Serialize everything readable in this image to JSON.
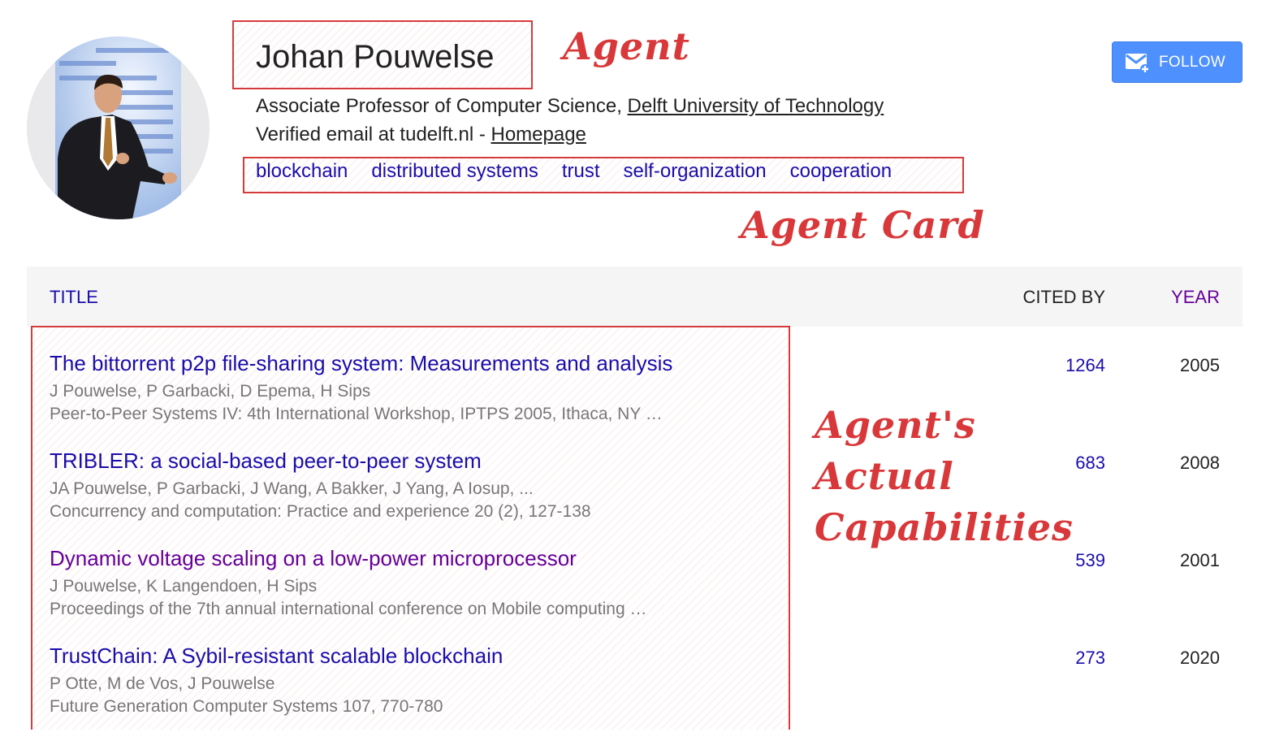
{
  "profile": {
    "name": "Johan Pouwelse",
    "affiliation_prefix": "Associate Professor of Computer Science, ",
    "affiliation_link": "Delft University of Technology",
    "email_prefix": "Verified email at tudelft.nl - ",
    "homepage_link": "Homepage",
    "interests": [
      "blockchain",
      "distributed systems",
      "trust",
      "self-organization",
      "cooperation"
    ],
    "follow_label": "FOLLOW",
    "follow_icon": "mail-plus-icon",
    "avatar_icon": "person-presenting-photo"
  },
  "annotations": {
    "agent": "Agent",
    "agent_card": "Agent Card",
    "capabilities_line1": "Agent's",
    "capabilities_line2": "Actual",
    "capabilities_line3": "Capabilities",
    "color": "#d9383a"
  },
  "table": {
    "col_title": "TITLE",
    "col_cited": "CITED BY",
    "col_year": "YEAR",
    "rows": [
      {
        "title": "The bittorrent p2p file-sharing system: Measurements and analysis",
        "authors": "J Pouwelse, P Garbacki, D Epema, H Sips",
        "venue": "Peer-to-Peer Systems IV: 4th International Workshop, IPTPS 2005, Ithaca, NY …",
        "cited": "1264",
        "year": "2005"
      },
      {
        "title": "TRIBLER: a social-based peer-to-peer system",
        "authors": "JA Pouwelse, P Garbacki, J Wang, A Bakker, J Yang, A Iosup, ...",
        "venue": "Concurrency and computation: Practice and experience 20 (2), 127-138",
        "cited": "683",
        "year": "2008"
      },
      {
        "title": "Dynamic voltage scaling on a low-power microprocessor",
        "authors": "J Pouwelse, K Langendoen, H Sips",
        "venue": "Proceedings of the 7th annual international conference on Mobile computing …",
        "cited": "539",
        "year": "2001"
      },
      {
        "title": "TrustChain: A Sybil-resistant scalable blockchain",
        "authors": "P Otte, M de Vos, J Pouwelse",
        "venue": "Future Generation Computer Systems 107, 770-780",
        "cited": "273",
        "year": "2020"
      }
    ]
  },
  "colors": {
    "link": "#1a0dab",
    "visited_link": "#660099",
    "follow_button": "#4d90fe",
    "annotation": "#d63b3b"
  }
}
